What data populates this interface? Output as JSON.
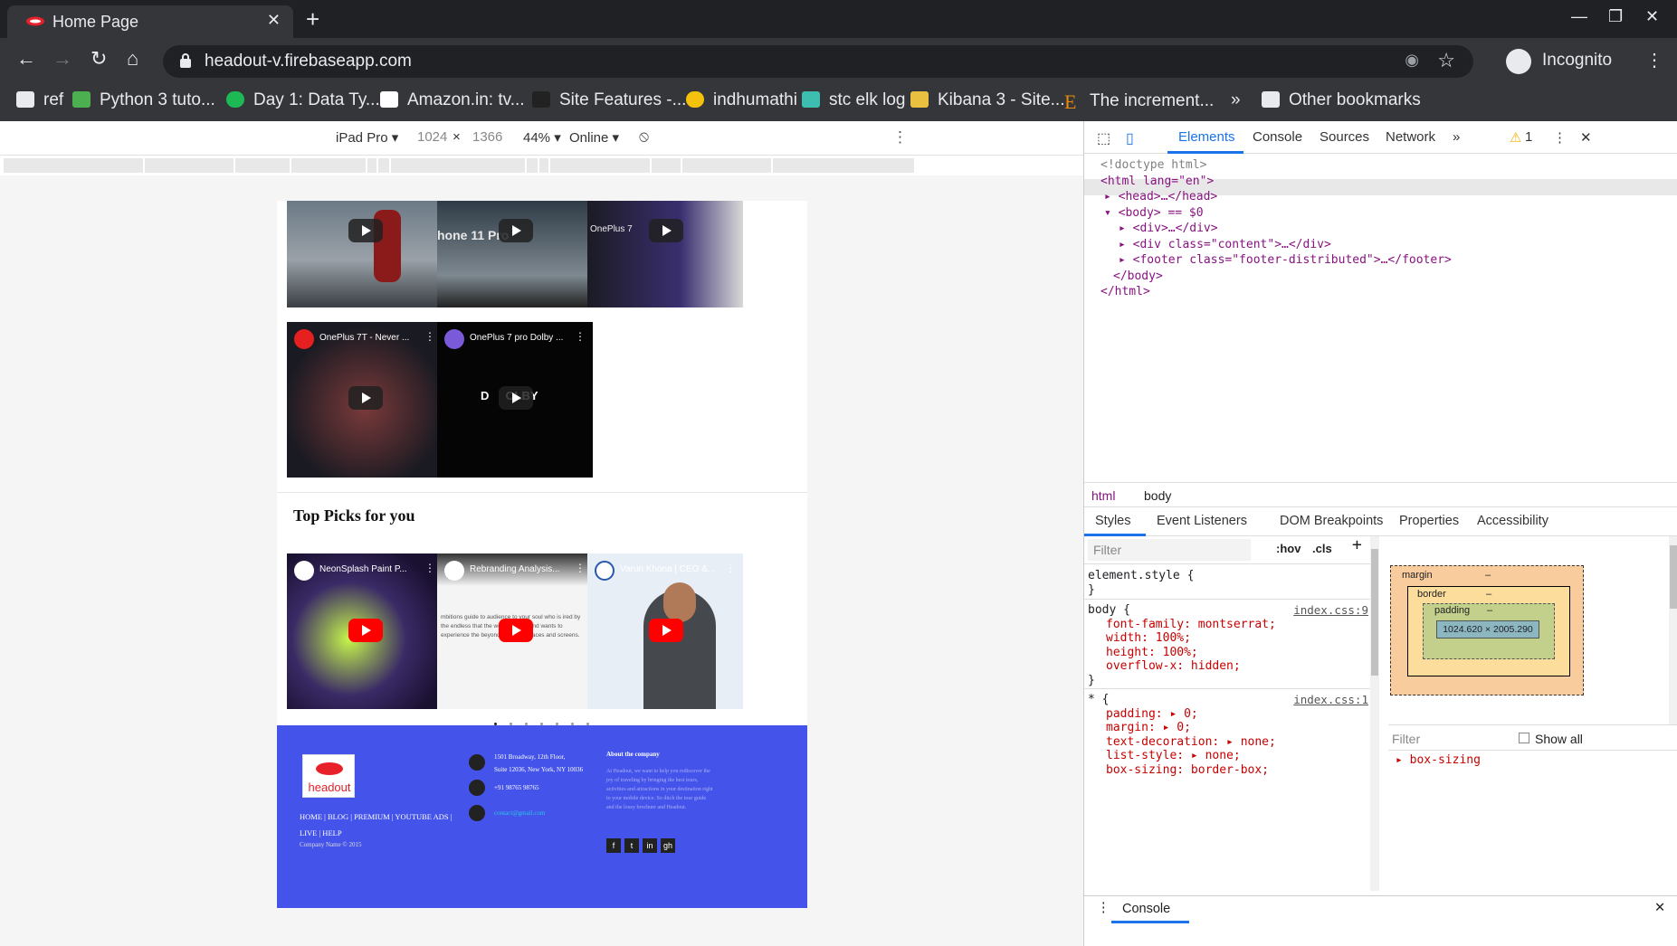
{
  "browser": {
    "tab_title": "Home Page",
    "url": "headout-v.firebaseapp.com",
    "profile": "Incognito",
    "bookmarks": [
      "ref",
      "Python 3 tuto...",
      "Day 1: Data Ty...",
      "Amazon.in: tv...",
      "Site Features -...",
      "indhumathi",
      "stc elk log",
      "Kibana 3 - Site...",
      "The increment..."
    ],
    "other_bookmarks": "Other bookmarks",
    "more": "»"
  },
  "device_toolbar": {
    "device": "iPad Pro",
    "width": "1024",
    "times": "×",
    "height": "1366",
    "zoom": "44%",
    "network": "Online"
  },
  "page": {
    "videos_top": [
      {
        "title": "",
        "color": "#6b7a86"
      },
      {
        "title": "",
        "color": "#3d4a55"
      },
      {
        "title": "",
        "color": "#1b1b24"
      }
    ],
    "videos_mid": [
      {
        "title": "OnePlus 7T - Never ...",
        "color": "#2a1b22"
      },
      {
        "title": "OnePlus 7 pro Dolby ...",
        "color": "#050505"
      }
    ],
    "top_picks_heading": "Top Picks for you",
    "videos_picks": [
      {
        "title": "NeonSplash Paint P...",
        "color": "#2a2a5a"
      },
      {
        "title": "Rebranding Analysis...",
        "color": "#f2f2f2"
      },
      {
        "title": "Varun Khona | CEO &...",
        "color": "#e8eef6"
      }
    ],
    "footer": {
      "logo_text": "headout",
      "links": "HOME | BLOG | PREMIUM | YOUTUBE ADS | LIVE | HELP",
      "copyright": "Company Name © 2015",
      "address_line1": "1501 Broadway, 12th Floor,",
      "address_line2": "Suite 12036, New York, NY 10036",
      "phone": "+91 98765 98765",
      "email": "contact@gmail.com",
      "about_title": "About the company",
      "about_text": "At Headout, we want to help you rediscover the joy of traveling by bringing the best tours, activities and attractions in your destination right to your mobile device. So ditch the tour guide and the lousy brochure and Headout.",
      "social": [
        "f",
        "t",
        "in",
        "gh"
      ]
    }
  },
  "devtools": {
    "tabs": [
      "Elements",
      "Console",
      "Sources",
      "Network"
    ],
    "warning_count": "1",
    "dom": {
      "doctype": "<!doctype html>",
      "html_open": "<html lang=\"en\">",
      "head": "<head>…</head>",
      "body_open": "<body> == $0",
      "div": "<div>…</div>",
      "div_content": "<div class=\"content\">…</div>",
      "footer": "<footer class=\"footer-distributed\">…</footer>",
      "body_close": "</body>",
      "html_close": "</html>"
    },
    "breadcrumbs": [
      "html",
      "body"
    ],
    "subtabs": [
      "Styles",
      "Event Listeners",
      "DOM Breakpoints",
      "Properties",
      "Accessibility"
    ],
    "filter_placeholder": "Filter",
    "hov": ":hov",
    "cls": ".cls",
    "styles": {
      "element_style": "element.style {",
      "body_selector": "body {",
      "body_source": "index.css:9",
      "body_rules": [
        "font-family: montserrat;",
        "width: 100%;",
        "height: 100%;",
        "overflow-x: hidden;"
      ],
      "star_selector": "* {",
      "star_source": "index.css:1",
      "star_rules": [
        "padding: ▸ 0;",
        "margin: ▸ 0;",
        "text-decoration: ▸ none;",
        "list-style: ▸ none;",
        "box-sizing: border-box;"
      ]
    },
    "box_model": {
      "margin_label": "margin",
      "border_label": "border",
      "padding_label": "padding",
      "content_size": "1024.620 × 2005.290",
      "dash": "–"
    },
    "computed_filter": "Filter",
    "show_all": "Show all",
    "computed_prop": "box-sizing",
    "console_label": "Console"
  }
}
